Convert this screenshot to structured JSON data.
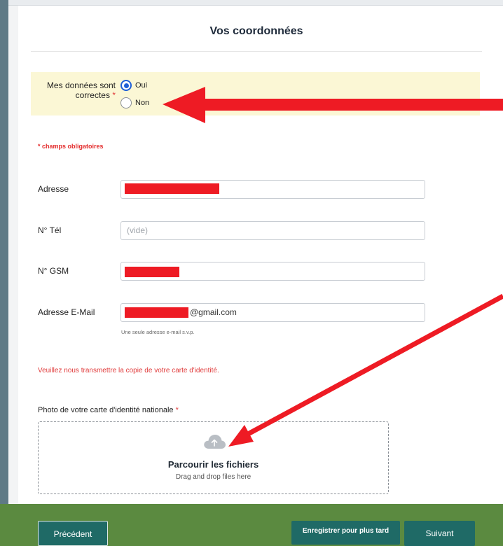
{
  "form": {
    "title": "Vos coordonnées",
    "confirm": {
      "label": "Mes données sont correctes",
      "required_mark": "*",
      "options": [
        {
          "label": "Oui",
          "selected": true
        },
        {
          "label": "Non",
          "selected": false
        }
      ]
    },
    "required_note": "* champs obligatoires",
    "fields": {
      "address": {
        "label": "Adresse",
        "value": ""
      },
      "phone": {
        "label": "N° Tél",
        "placeholder": "(vide)",
        "value": ""
      },
      "gsm": {
        "label": "N° GSM",
        "value": ""
      },
      "email": {
        "label": "Adresse E-Mail",
        "value_suffix": "@gmail.com",
        "hint": "Une seule adresse e-mail s.v.p."
      }
    },
    "id_notice": "Veuillez nous transmettre la copie de votre carte d'identité.",
    "photo": {
      "label": "Photo de votre carte d'identité nationale",
      "required_mark": "*",
      "drop_title": "Parcourir les fichiers",
      "drop_subtitle": "Drag and drop files here",
      "icon": "cloud-upload-icon"
    }
  },
  "footer": {
    "prev_label": "Précédent",
    "save_label": "Enregistrer pour plus tard",
    "next_label": "Suivant"
  },
  "annotations": {
    "arrow_color": "#ee1b24",
    "redaction_color": "#ee1b24"
  },
  "theme": {
    "footer_bg": "#5b8a40",
    "button_bg": "#1f6a66",
    "confirm_bg": "#fbf7d5",
    "radio_accent": "#1f5fd6",
    "required_color": "#e03b3b"
  }
}
